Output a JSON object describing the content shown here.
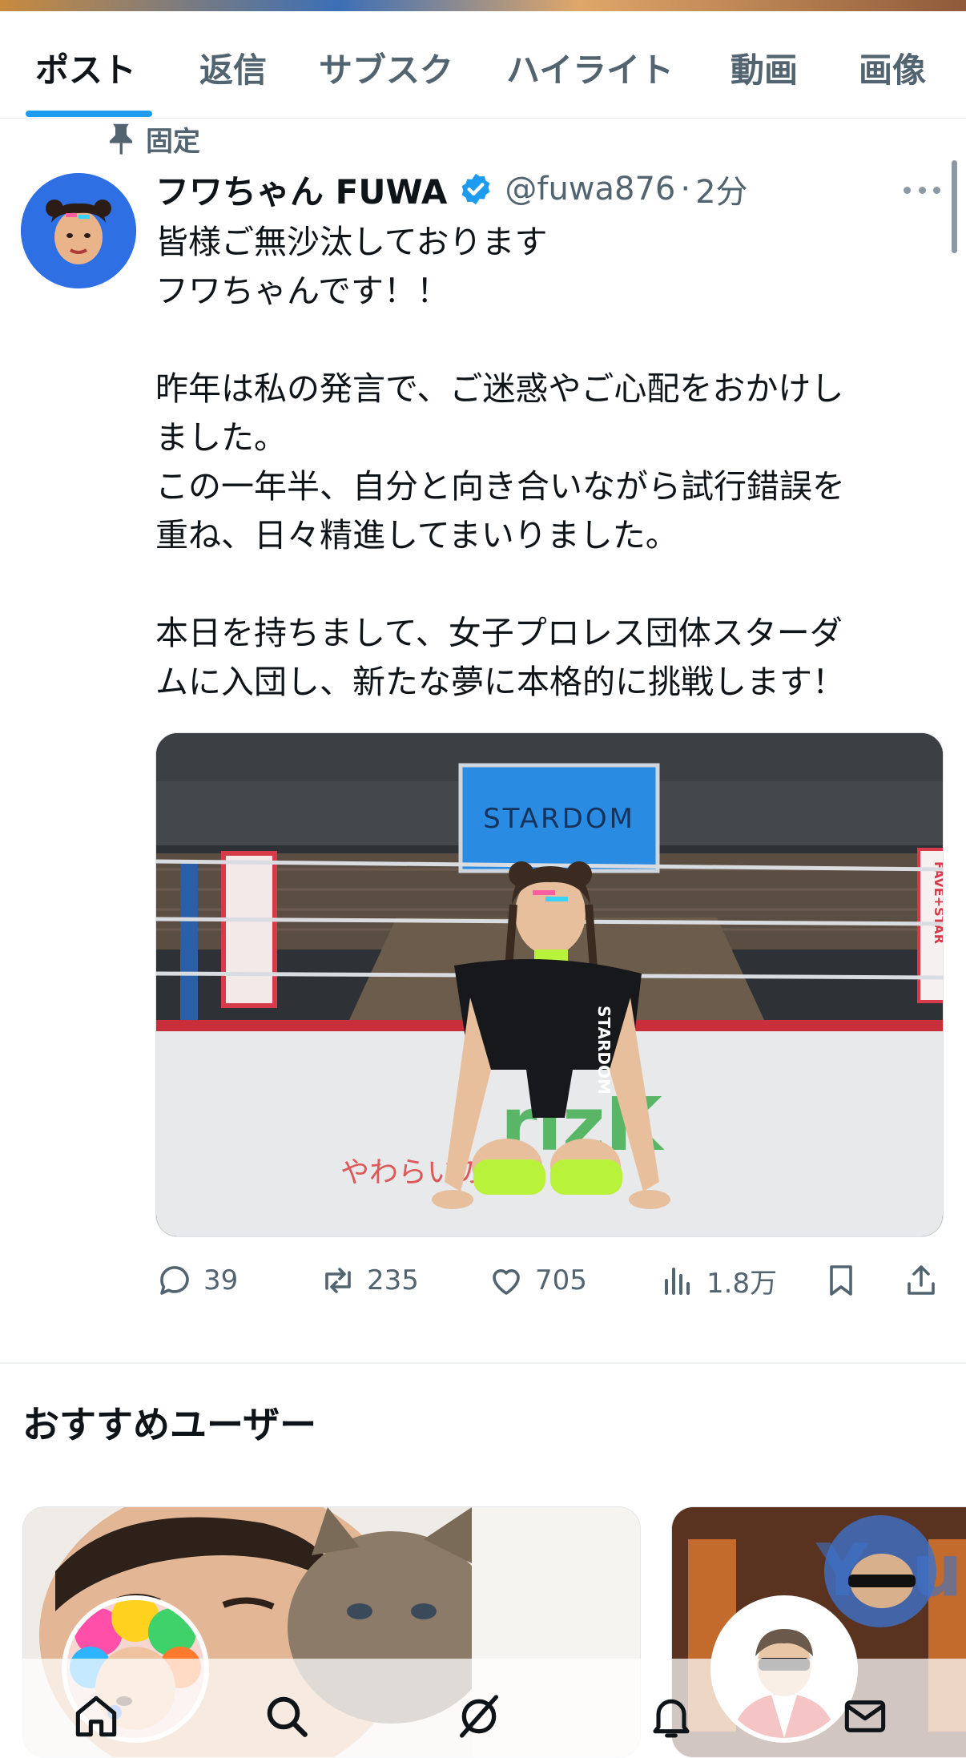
{
  "tabs": [
    {
      "label": "ポスト",
      "active": true
    },
    {
      "label": "返信"
    },
    {
      "label": "サブスク"
    },
    {
      "label": "ハイライト"
    },
    {
      "label": "動画"
    },
    {
      "label": "画像"
    }
  ],
  "pinned_label": "固定",
  "tweet": {
    "display_name": "フワちゃん FUWA",
    "handle": "@fuwa876",
    "separator": "·",
    "time": "2分",
    "lines": [
      "皆様ご無沙汰しております",
      "フワちゃんです！！",
      "",
      "昨年は私の発言で、ご迷惑やご心配をおかけし",
      "ました。",
      "この一年半、自分と向き合いながら試行錯誤を",
      "重ね、日々精進してまいりました。",
      "",
      "本日を持ちまして、女子プロレス団体スターダ",
      "ムに入団し、新たな夢に本格的に挑戦します！"
    ],
    "media": {
      "screen_text": "STARDOM",
      "shirt_text": "STARDOM",
      "mat_text": "rizK",
      "mat_subtext": "やわらいのちに",
      "banner_text": "FAVE+STAR"
    },
    "actions": {
      "replies": "39",
      "reposts": "235",
      "likes": "705",
      "views": "1.8万"
    }
  },
  "recommended": {
    "title": "おすすめユーザー"
  },
  "colors": {
    "accent": "#1d9bf0",
    "verified": "#1d9bf0",
    "secondary_text": "#536471",
    "avatar_bg": "#2f6fe4"
  },
  "icons": {
    "nav": [
      "home-icon",
      "search-icon",
      "grok-icon",
      "notifications-icon",
      "messages-icon"
    ],
    "actions": [
      "reply-icon",
      "repost-icon",
      "like-icon",
      "views-icon",
      "bookmark-icon",
      "share-icon"
    ]
  }
}
